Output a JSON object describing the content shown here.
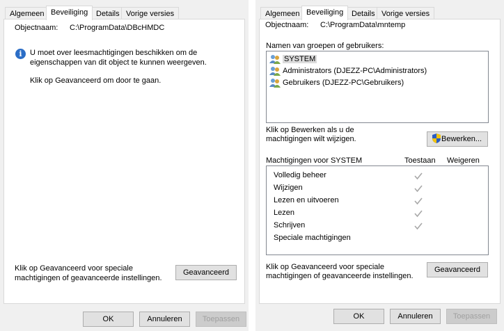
{
  "left_dialog": {
    "tabs": [
      "Algemeen",
      "Beveiliging",
      "Details",
      "Vorige versies"
    ],
    "active_tab": "Beveiliging",
    "object_label": "Objectnaam:",
    "object_value": "C:\\ProgramData\\DBcHMDC",
    "info_line1": "U moet over leesmachtigingen beschikken om de",
    "info_line2": "eigenschappen van dit object te kunnen weergeven.",
    "continue_text": "Klik op Geavanceerd om door te gaan.",
    "advanced_text_line1": "Klik op Geavanceerd voor speciale",
    "advanced_text_line2": "machtigingen of geavanceerde instellingen.",
    "advanced_button": "Geavanceerd",
    "ok_button": "OK",
    "cancel_button": "Annuleren",
    "apply_button": "Toepassen"
  },
  "right_dialog": {
    "tabs": [
      "Algemeen",
      "Beveiliging",
      "Details",
      "Vorige versies"
    ],
    "active_tab": "Beveiliging",
    "object_label": "Objectnaam:",
    "object_value": "C:\\ProgramData\\mntemp",
    "groups_label": "Namen van groepen of gebruikers:",
    "users": [
      {
        "name": "SYSTEM",
        "icon": "user-group-icon",
        "selected": true
      },
      {
        "name": "Administrators (DJEZZ-PC\\Administrators)",
        "icon": "user-group-icon",
        "selected": false
      },
      {
        "name": "Gebruikers (DJEZZ-PC\\Gebruikers)",
        "icon": "user-group-icon",
        "selected": false
      }
    ],
    "edit_text_line1": "Klik op Bewerken als u de",
    "edit_text_line2": "machtigingen wilt wijzigen.",
    "edit_button": "Bewerken...",
    "permissions_label": "Machtigingen voor SYSTEM",
    "allow_header": "Toestaan",
    "deny_header": "Weigeren",
    "permissions": [
      {
        "name": "Volledig beheer",
        "allow": true,
        "deny": false
      },
      {
        "name": "Wijzigen",
        "allow": true,
        "deny": false
      },
      {
        "name": "Lezen en uitvoeren",
        "allow": true,
        "deny": false
      },
      {
        "name": "Lezen",
        "allow": true,
        "deny": false
      },
      {
        "name": "Schrijven",
        "allow": true,
        "deny": false
      },
      {
        "name": "Speciale machtigingen",
        "allow": false,
        "deny": false
      }
    ],
    "advanced_text_line1": "Klik op Geavanceerd voor speciale",
    "advanced_text_line2": "machtigingen of geavanceerde instellingen.",
    "advanced_button": "Geavanceerd",
    "ok_button": "OK",
    "cancel_button": "Annuleren",
    "apply_button": "Toepassen"
  },
  "colors": {
    "info_icon": "#2b6dc6",
    "check_gray": "#a8a8a8",
    "shield_blue": "#2a5cc4",
    "shield_yellow": "#f2c40c"
  }
}
